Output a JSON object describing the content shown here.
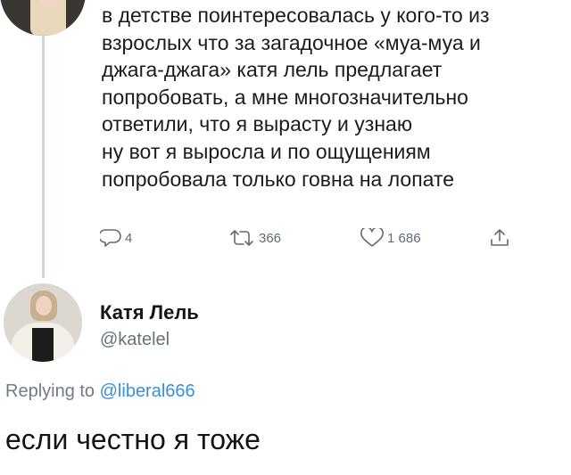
{
  "original_tweet": {
    "lines": [
      "в детстве поинтересовалась у кого-то из",
      "взрослых что за загадочное «муа-муа и",
      "джага-джага» катя лель предлагает",
      "попробовать, а мне многозначительно",
      "ответили, что я вырасту и узнаю",
      "ну вот я выросла и по ощущениям",
      "попробовала только говна на лопате"
    ],
    "actions": {
      "reply_icon": "reply-bubble-icon",
      "reply_count": "4",
      "retweet_icon": "retweet-icon",
      "retweet_count": "366",
      "like_icon": "heart-icon",
      "like_count": "1 686",
      "share_icon": "share-icon"
    }
  },
  "reply": {
    "name": "Катя Лель",
    "handle": "@katelel",
    "replying_prefix": "Replying to",
    "replying_to": "@liberal666",
    "text": "если честно я тоже"
  },
  "colors": {
    "text": "#1b1b1b",
    "muted": "#66737d",
    "link": "#3a8fd6",
    "thread_line": "#cfd6dc"
  }
}
